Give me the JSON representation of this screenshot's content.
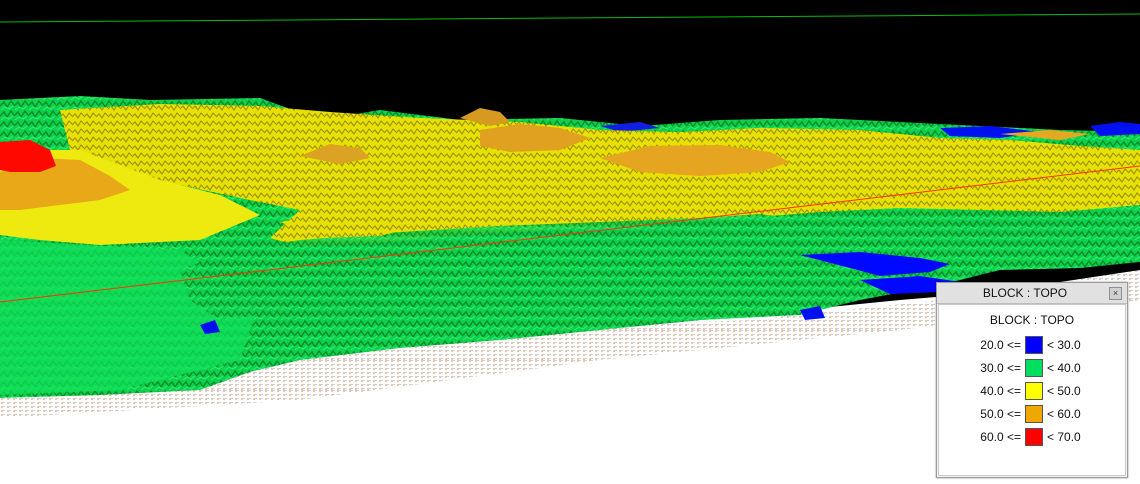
{
  "legend": {
    "window_title": "BLOCK : TOPO",
    "heading": "BLOCK : TOPO",
    "close_glyph": "×",
    "items": [
      {
        "low": "20.0 <=",
        "high": "< 30.0",
        "color": "#0000ff"
      },
      {
        "low": "30.0 <=",
        "high": "< 40.0",
        "color": "#00e060"
      },
      {
        "low": "40.0 <=",
        "high": "< 50.0",
        "color": "#ffff00"
      },
      {
        "low": "50.0 <=",
        "high": "< 60.0",
        "color": "#f0a800"
      },
      {
        "low": "60.0 <=",
        "high": "< 70.0",
        "color": "#ff0000"
      }
    ]
  },
  "scene": {
    "background": "#000000",
    "horizon_line_color": "#00c000",
    "section_line_color": "#ff3300",
    "icons": [
      "close-icon"
    ]
  }
}
